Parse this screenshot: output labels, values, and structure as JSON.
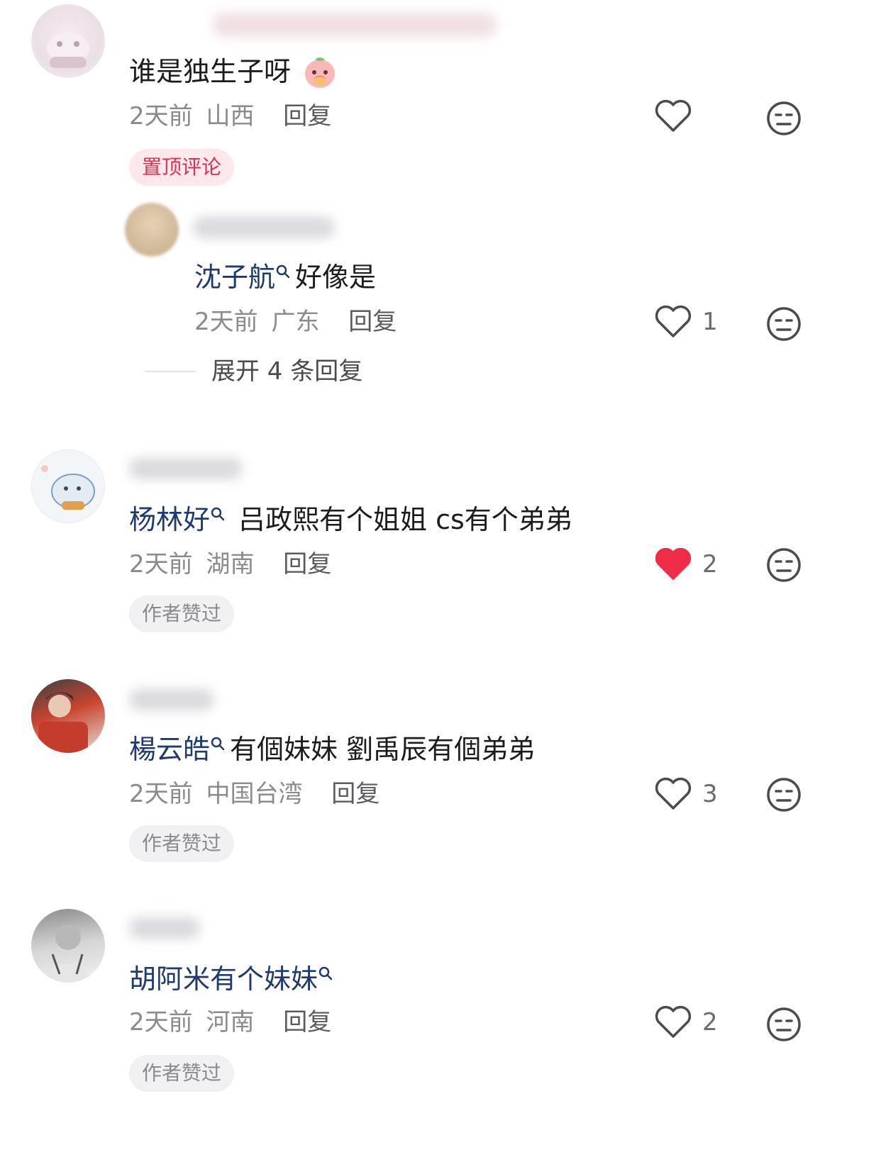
{
  "comments": [
    {
      "content": "谁是独生子呀",
      "emoji": "peach-face-emoji",
      "time": "2天前",
      "location": "山西",
      "reply_label": "回复",
      "like_count": "",
      "liked": false,
      "tag": "置顶评论",
      "sub_reply": {
        "mention": "沈子航",
        "content": "好像是",
        "time": "2天前",
        "location": "广东",
        "reply_label": "回复",
        "like_count": "1"
      },
      "expand_label": "展开 4 条回复"
    },
    {
      "mention": "杨林好",
      "content": "吕政熙有个姐姐 cs有个弟弟",
      "time": "2天前",
      "location": "湖南",
      "reply_label": "回复",
      "like_count": "2",
      "liked": true,
      "tag": "作者赞过"
    },
    {
      "mention": "楊云皓",
      "content": "有個妹妹 劉禹辰有個弟弟",
      "time": "2天前",
      "location": "中国台湾",
      "reply_label": "回复",
      "like_count": "3",
      "liked": false,
      "tag": "作者赞过"
    },
    {
      "mention": "胡阿米有个妹妹",
      "content": "",
      "time": "2天前",
      "location": "河南",
      "reply_label": "回复",
      "like_count": "2",
      "liked": false,
      "tag": "作者赞过"
    }
  ],
  "colors": {
    "mention": "#1f3a6e",
    "liked_heart": "#f02d48",
    "pinned_tag_text": "#e0304e",
    "meta_gray": "#8a8a8f"
  },
  "icons": {
    "like": "heart-outline-icon",
    "liked": "heart-filled-icon",
    "dislike": "neutral-face-icon",
    "mention_search": "search-mini-icon"
  }
}
